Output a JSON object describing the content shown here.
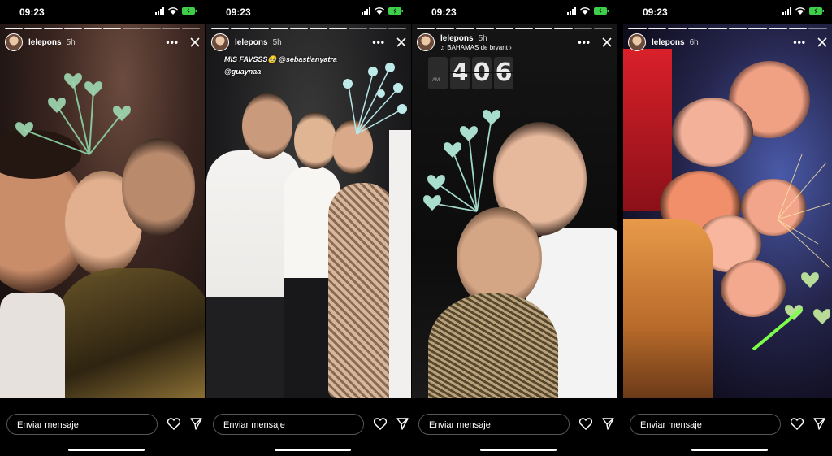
{
  "status": {
    "time": "09:23"
  },
  "panels": [
    {
      "user": "lelepons",
      "age": "5h",
      "caption": [],
      "music": "",
      "clock": []
    },
    {
      "user": "lelepons",
      "age": "5h",
      "caption": [
        "MIS FAVSSS🥹 @sebastianyatra",
        "@guaynaa"
      ],
      "music": "",
      "clock": []
    },
    {
      "user": "lelepons",
      "age": "5h",
      "caption": [],
      "music": "♫ BAHAMAS de bryant ›",
      "clock": [
        "AM",
        "4",
        "0",
        "6"
      ]
    },
    {
      "user": "lelepons",
      "age": "6h",
      "caption": [],
      "music": "",
      "clock": []
    }
  ],
  "footer": {
    "message_placeholder": "Enviar mensaje"
  },
  "icons": {
    "more": "more-icon",
    "close": "close-icon",
    "like": "heart-icon",
    "share": "send-icon"
  }
}
